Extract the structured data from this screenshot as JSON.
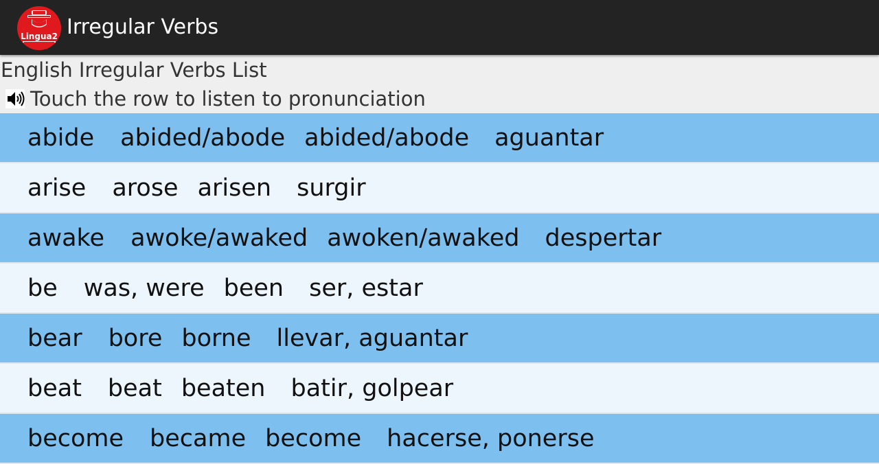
{
  "header": {
    "title": "Irregular Verbs",
    "logo_text": "Lingua2",
    "background": "#232323",
    "logo_color": "#e0191f"
  },
  "subtitle": "English Irregular Verbs List",
  "hint": {
    "icon": "speaker-icon",
    "text": "Touch the row to listen to pronunciation"
  },
  "colors": {
    "row_blue": "#7dbfef",
    "row_light": "#eef6fd"
  },
  "verbs": [
    {
      "base": "abide",
      "past": "abided/abode",
      "participle": "abided/abode",
      "translation": "aguantar"
    },
    {
      "base": "arise",
      "past": "arose",
      "participle": "arisen",
      "translation": "surgir"
    },
    {
      "base": "awake",
      "past": "awoke/awaked",
      "participle": "awoken/awaked",
      "translation": "despertar"
    },
    {
      "base": "be",
      "past": "was, were",
      "participle": "been",
      "translation": "ser, estar"
    },
    {
      "base": "bear",
      "past": "bore",
      "participle": "borne",
      "translation": "llevar, aguantar"
    },
    {
      "base": "beat",
      "past": "beat",
      "participle": "beaten",
      "translation": "batir, golpear"
    },
    {
      "base": "become",
      "past": "became",
      "participle": "become",
      "translation": "hacerse, ponerse"
    }
  ]
}
